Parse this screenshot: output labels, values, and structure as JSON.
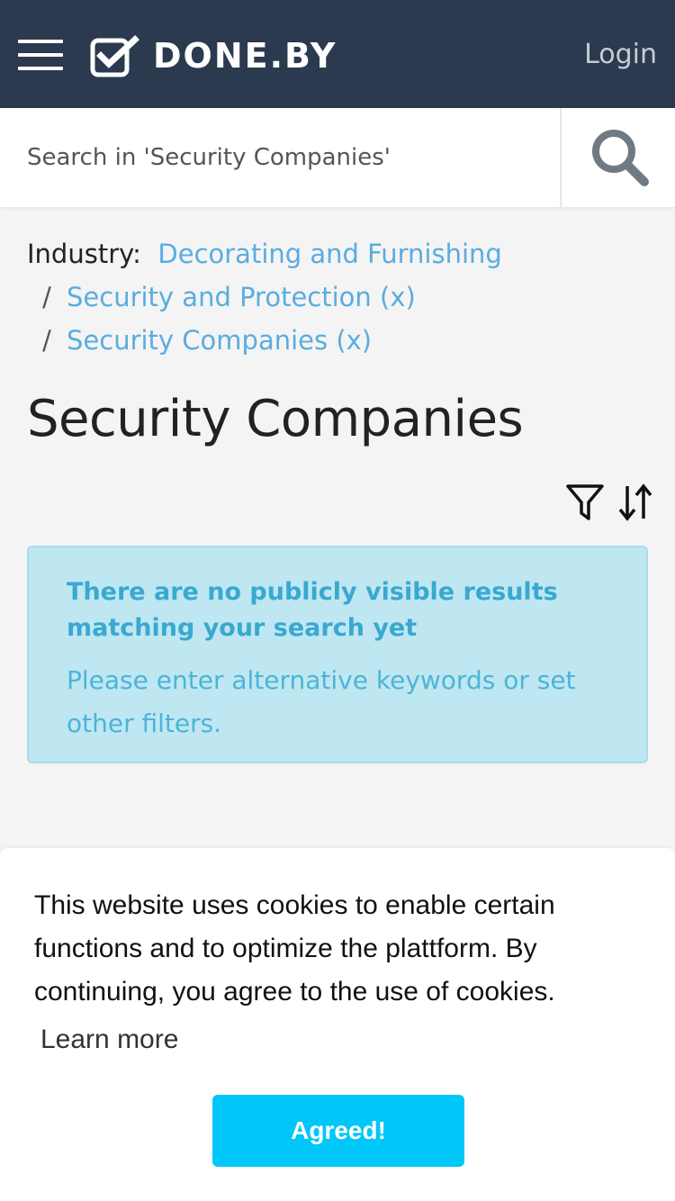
{
  "header": {
    "brand": "DONE.BY",
    "login_label": "Login"
  },
  "search": {
    "placeholder": "Search in 'Security Companies'"
  },
  "breadcrumb": {
    "label": "Industry:",
    "items": [
      "Decorating and Furnishing",
      "Security and Protection (x)",
      "Security Companies (x)"
    ],
    "separator": "/"
  },
  "page": {
    "title": "Security Companies"
  },
  "alert": {
    "heading": "There are no publicly visible results matching your search yet",
    "body": "Please enter alternative keywords or set other filters."
  },
  "cookie": {
    "text": "This website uses cookies to enable certain functions and to optimize the plattform. By continuing, you agree to the use of cookies.",
    "learn_more": "Learn more",
    "agree_label": "Agreed!"
  },
  "colors": {
    "header_bg": "#2b3a4e",
    "link": "#5aace0",
    "alert_bg": "#bee7f1",
    "alert_text": "#3aa8d0",
    "agree_button": "#00c7f7"
  }
}
